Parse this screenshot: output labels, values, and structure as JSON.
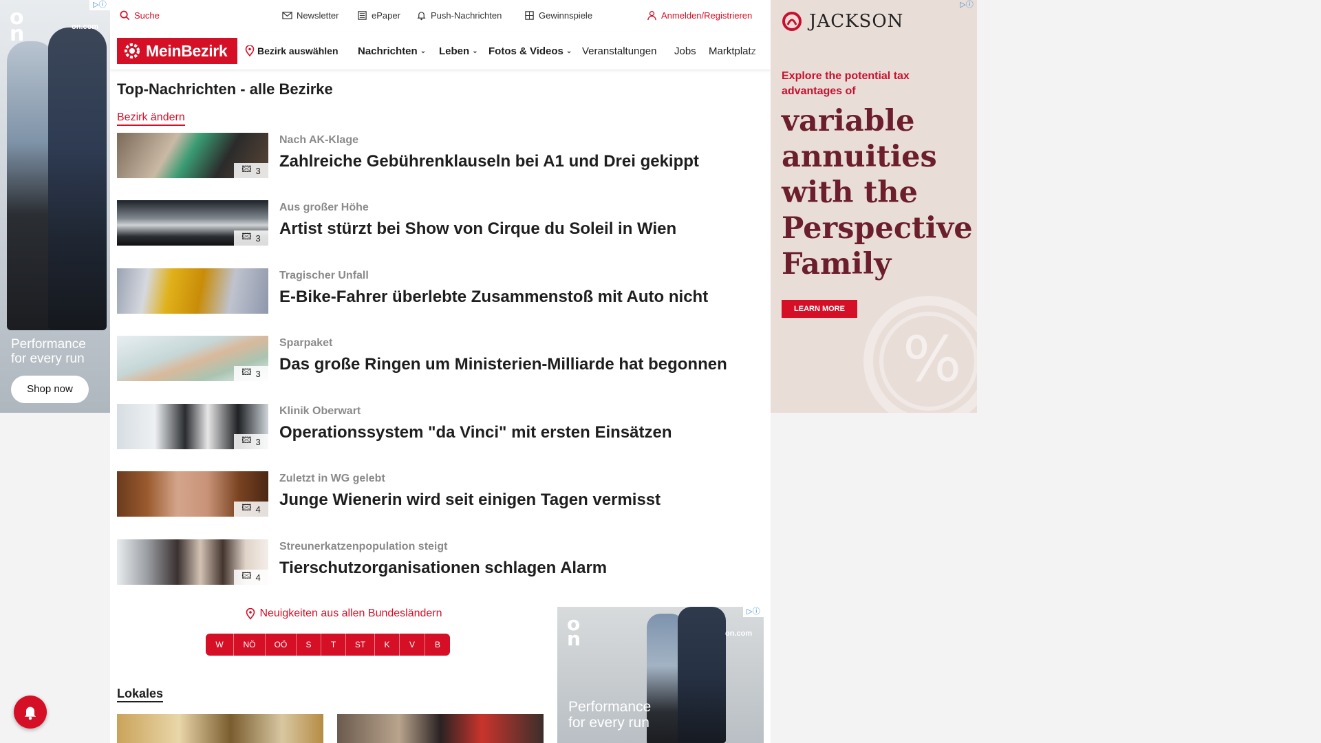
{
  "ad_left": {
    "domain": "on.com",
    "tagline_1": "Performance",
    "tagline_2": "for every run",
    "cta": "Shop now"
  },
  "topbar": {
    "search": "Suche",
    "newsletter": "Newsletter",
    "epaper": "ePaper",
    "push": "Push-Nachrichten",
    "games": "Gewinnspiele",
    "login": "Anmelden/Registrieren"
  },
  "nav": {
    "logo": "MeinBezirk",
    "select_district": "Bezirk auswählen",
    "items": [
      "Nachrichten",
      "Leben",
      "Fotos & Videos",
      "Veranstaltungen",
      "Jobs",
      "Marktplatz"
    ]
  },
  "page_title": "Top-Nachrichten - alle Bezirke",
  "change_district": "Bezirk ändern",
  "articles": [
    {
      "kicker": "Nach AK-Klage",
      "headline": "Zahlreiche Gebührenklauseln bei A1 und Drei gekippt",
      "images": "3"
    },
    {
      "kicker": "Aus großer Höhe",
      "headline": "Artist stürzt bei Show von Cirque du Soleil in Wien",
      "images": "3"
    },
    {
      "kicker": "Tragischer Unfall",
      "headline": "E-Bike-Fahrer überlebte Zusammenstoß mit Auto nicht",
      "images": ""
    },
    {
      "kicker": "Sparpaket",
      "headline": "Das große Ringen um Ministerien-Milliarde hat begonnen",
      "images": "3"
    },
    {
      "kicker": "Klinik Oberwart",
      "headline": "Operationssystem \"da Vinci\" mit ersten Einsätzen",
      "images": "3"
    },
    {
      "kicker": "Zuletzt in WG gelebt",
      "headline": "Junge Wienerin wird seit einigen Tagen vermisst",
      "images": "4"
    },
    {
      "kicker": "Streunerkatzenpopulation steigt",
      "headline": "Tierschutzorganisationen schlagen Alarm",
      "images": "4"
    }
  ],
  "states_title": "Neuigkeiten aus allen Bundesländern",
  "states": [
    "W",
    "NÖ",
    "OÖ",
    "S",
    "T",
    "ST",
    "K",
    "V",
    "B"
  ],
  "lokales": "Lokales",
  "ad_mid": {
    "domain": "on.com",
    "tagline_1": "Performance",
    "tagline_2": "for every run"
  },
  "ad_right": {
    "brand": "JACKSON",
    "sub": "Explore the potential tax advantages of",
    "headline": "variable annuities with the Perspective Family",
    "cta": "LEARN MORE",
    "symbol": "%"
  },
  "colors": {
    "brand_red": "#d50f25",
    "jackson_burgundy": "#6b1e2b"
  }
}
